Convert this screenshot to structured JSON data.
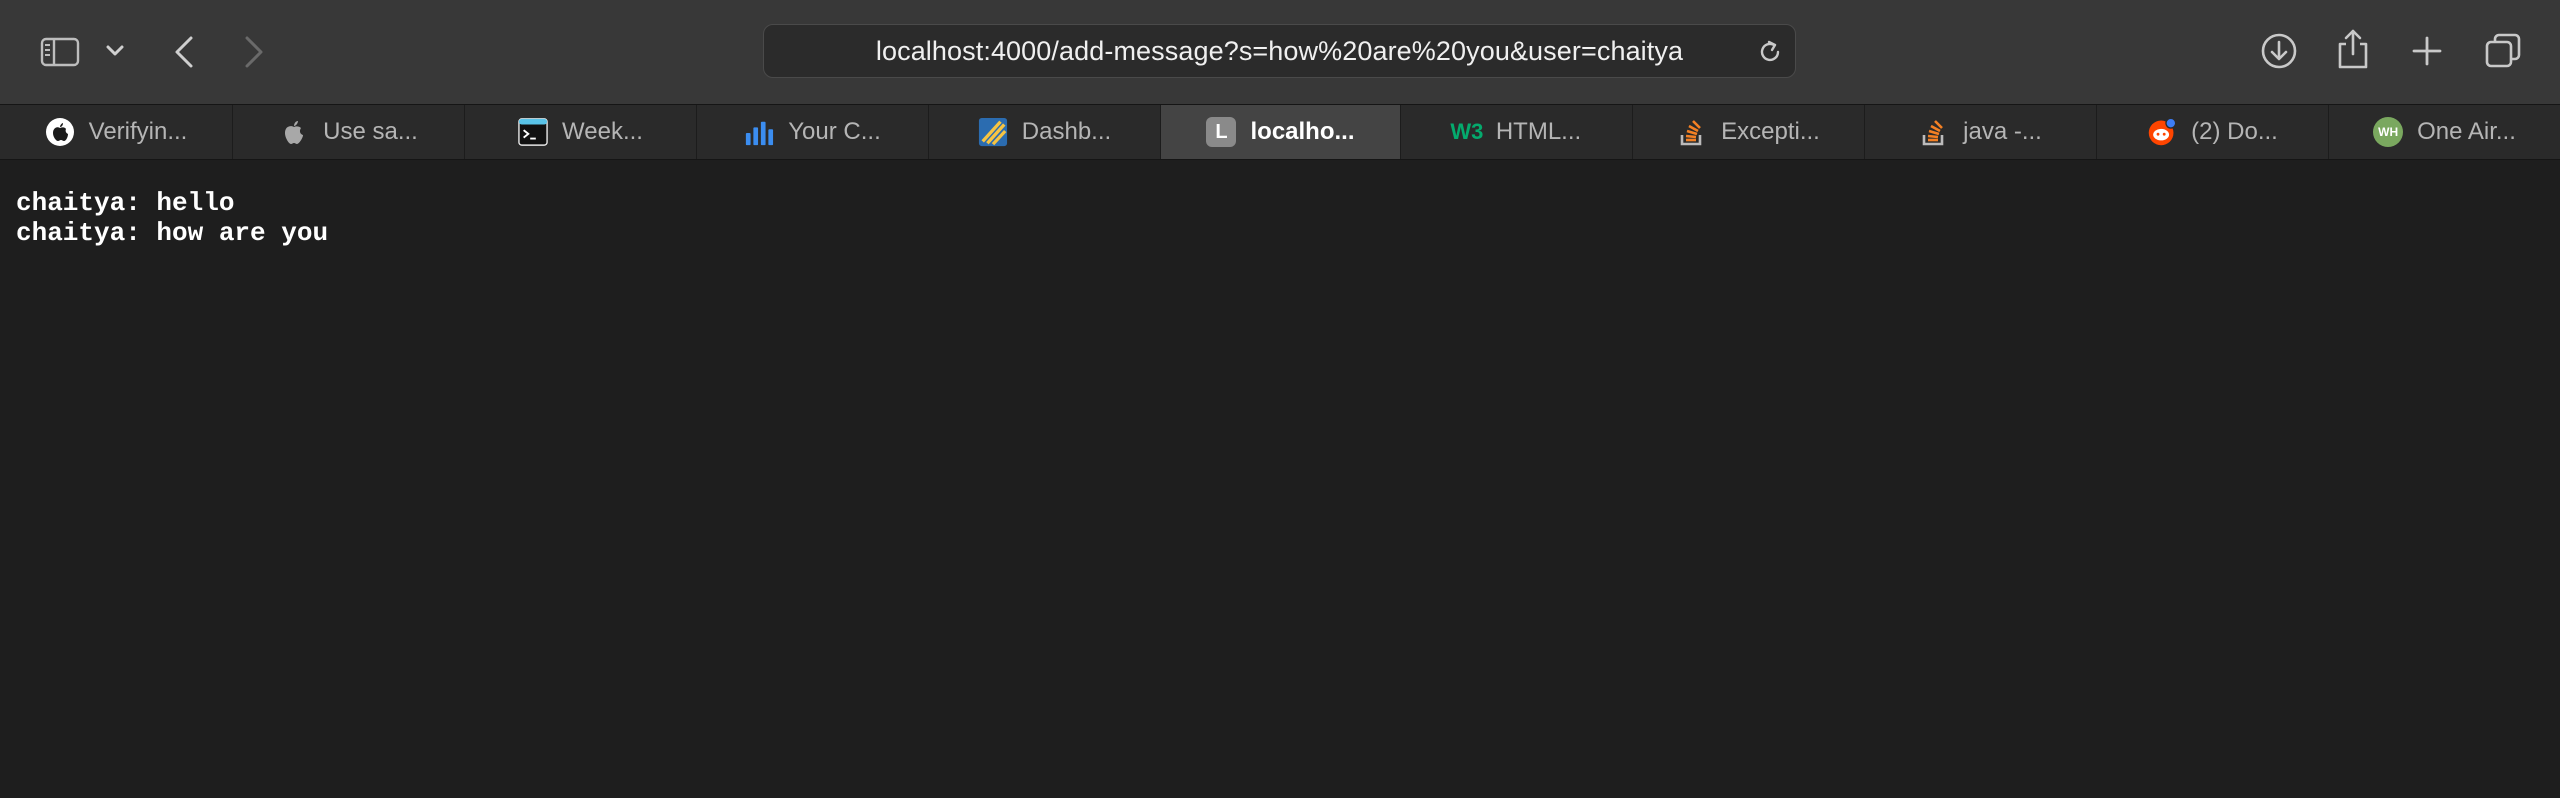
{
  "browser": {
    "url": "localhost:4000/add-message?s=how%20are%20you&user=chaitya"
  },
  "tabs": [
    {
      "label": "Verifyin...",
      "icon": "apple-logo-icon"
    },
    {
      "label": "Use sa...",
      "icon": "apple-gray-icon"
    },
    {
      "label": "Week...",
      "icon": "terminal-icon"
    },
    {
      "label": "Your C...",
      "icon": "bar-chart-icon"
    },
    {
      "label": "Dashb...",
      "icon": "dashboard-stripes-icon"
    },
    {
      "label": "localho...",
      "icon": "letter-l-icon",
      "favicon_letter": "L",
      "active": true
    },
    {
      "label": "HTML...",
      "icon": "w3schools-icon",
      "favicon_letter": "W3"
    },
    {
      "label": "Excepti...",
      "icon": "stackoverflow-icon"
    },
    {
      "label": "java -...",
      "icon": "stackoverflow-icon"
    },
    {
      "label": "(2) Do...",
      "icon": "reddit-icon"
    },
    {
      "label": "One Air...",
      "icon": "green-badge-icon",
      "favicon_letter": "WH"
    }
  ],
  "page": {
    "messages": [
      "chaitya: hello",
      "chaitya: how are you"
    ]
  },
  "colors": {
    "toolbar_bg": "#383838",
    "tabbar_bg": "#2a2a2a",
    "active_tab_bg": "#444444",
    "page_bg": "#1e1e1e",
    "text": "#ffffff"
  }
}
